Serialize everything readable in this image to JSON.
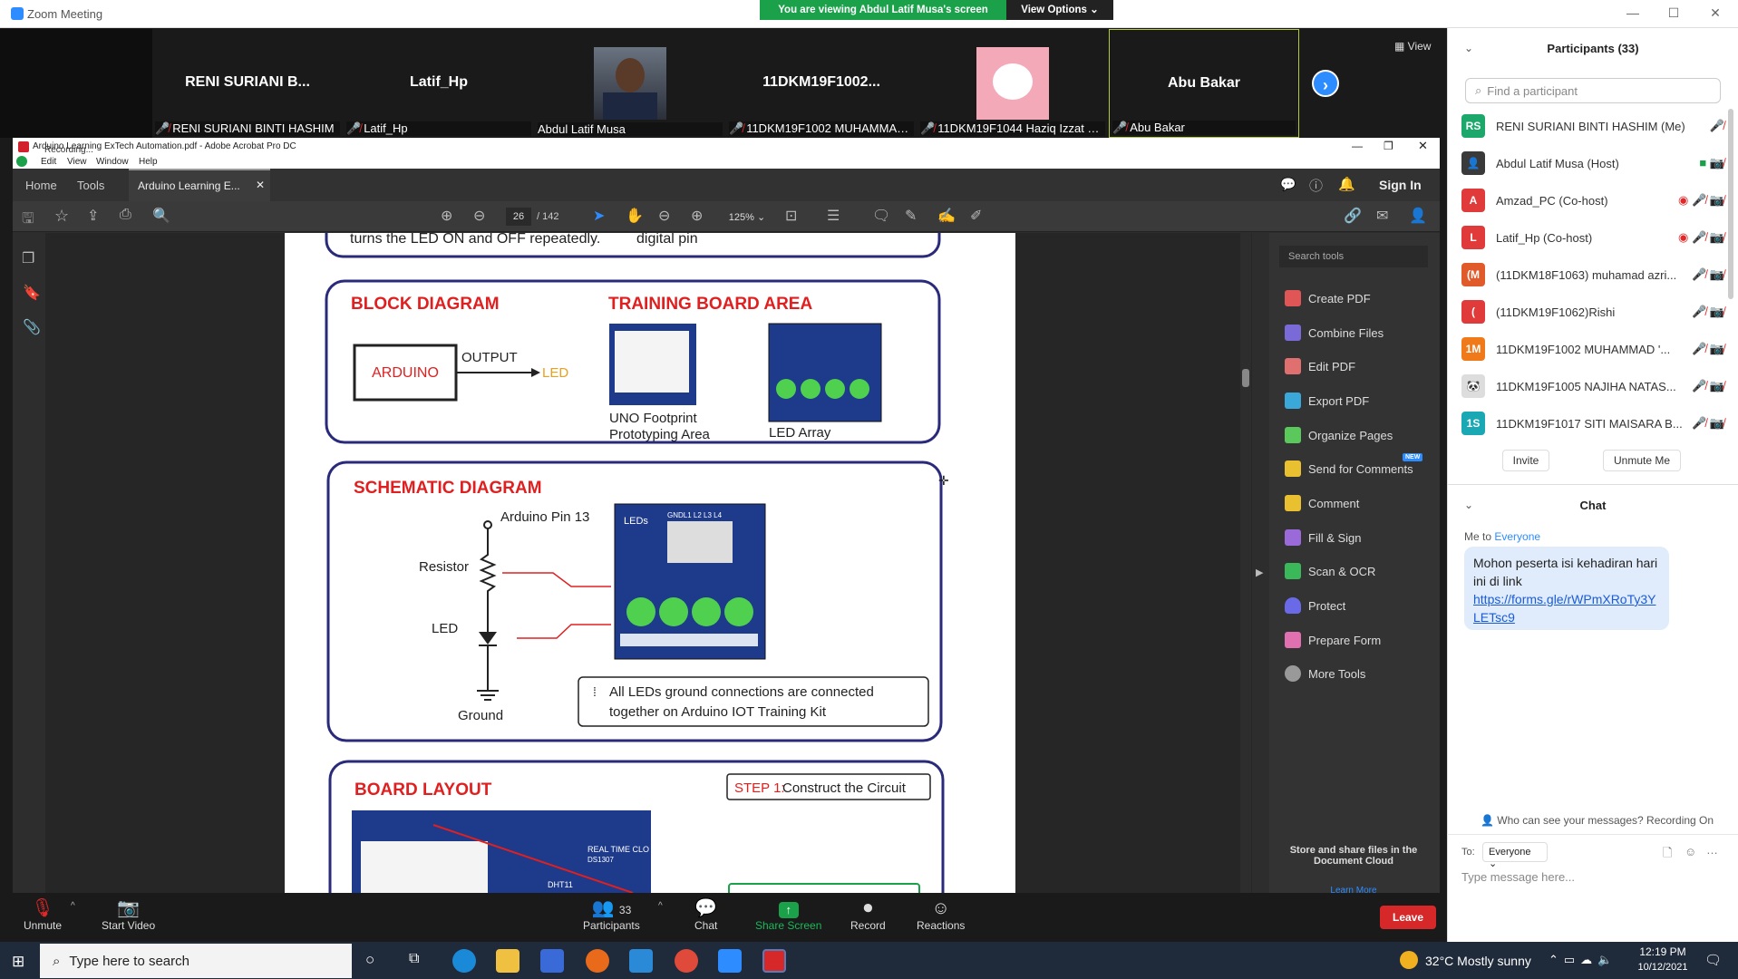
{
  "window": {
    "title": "Zoom Meeting",
    "viewing_banner": "You are viewing Abdul Latif Musa's screen",
    "view_options": "View Options"
  },
  "gallery": {
    "view_label": "View",
    "tiles": [
      {
        "name": "RENI SURIANI B...",
        "label": "RENI SURIANI BINTI HASHIM",
        "muted": true
      },
      {
        "name": "Latif_Hp",
        "label": "Latif_Hp",
        "muted": true
      },
      {
        "name": "",
        "label": "Abdul Latif Musa",
        "muted": false
      },
      {
        "name": "11DKM19F1002...",
        "label": "11DKM19F1002 MUHAMMAD...",
        "muted": true
      },
      {
        "name": "",
        "label": "11DKM19F1044 Haziq Izzat Bi...",
        "muted": true
      },
      {
        "name": "Abu Bakar",
        "label": "Abu Bakar",
        "muted": true
      }
    ]
  },
  "acrobat": {
    "title": "Arduino Learning ExTech Automation.pdf - Adobe Acrobat Pro DC",
    "recording": "Recording...",
    "menu": [
      "Edit",
      "View",
      "Window",
      "Help"
    ],
    "tabs": [
      "Home",
      "Tools",
      "Arduino Learning E..."
    ],
    "sign_in": "Sign In",
    "page_current": "26",
    "page_total": "/ 142",
    "zoom": "125%",
    "search_tools": "Search tools",
    "tools": [
      "Create PDF",
      "Combine Files",
      "Edit PDF",
      "Export PDF",
      "Organize Pages",
      "Send for Comments",
      "Comment",
      "Fill & Sign",
      "Scan & OCR",
      "Protect",
      "Prepare Form",
      "More Tools"
    ],
    "new_badge": "NEW",
    "cloud_promo": "Store and share files in the Document Cloud",
    "learn_more": "Learn More"
  },
  "doc": {
    "top_text_left": "turns the LED ON and OFF repeatedly.",
    "top_text_right": "digital pin",
    "block_title": "BLOCK DIAGRAM",
    "block_arduino": "ARDUINO",
    "block_output": "OUTPUT",
    "block_led": "LED",
    "training_title": "TRAINING BOARD AREA",
    "uno_caption_1": "UNO Footprint",
    "uno_caption_2": "Prototyping Area",
    "led_array": "LED Array",
    "led_board_label": "LEDs",
    "led_board_pins": "GNDL1 L2 L3 L4",
    "led_labels": [
      "L1",
      "L2",
      "L3",
      "L4"
    ],
    "schem_title": "SCHEMATIC DIAGRAM",
    "schem_pin": "Arduino Pin 13",
    "schem_resistor": "Resistor",
    "schem_led": "LED",
    "schem_ground": "Ground",
    "schem_note_1": "All LEDs ground connections are connected",
    "schem_note_2": "together on Arduino IOT Training Kit",
    "board_title": "BOARD LAYOUT",
    "step_label": "STEP 1:",
    "step_text": "Construct the Circuit",
    "rtc_label": "REAL TIME CLO",
    "rtc_code": "DS1307",
    "dht_label": "DHT11"
  },
  "controls": {
    "unmute": "Unmute",
    "start_video": "Start Video",
    "participants": "Participants",
    "participants_count": "33",
    "chat": "Chat",
    "share_screen": "Share Screen",
    "record": "Record",
    "reactions": "Reactions",
    "leave": "Leave"
  },
  "panel": {
    "title": "Participants (33)",
    "find_placeholder": "Find a participant",
    "participants": [
      {
        "initials": "RS",
        "color": "#1ba86a",
        "name": "RENI SURIANI BINTI HASHIM (Me)"
      },
      {
        "initials": "",
        "color": "#555",
        "name": "Abdul Latif Musa (Host)"
      },
      {
        "initials": "A",
        "color": "#e03a3a",
        "name": "Amzad_PC (Co-host)"
      },
      {
        "initials": "L",
        "color": "#e03a3a",
        "name": "Latif_Hp (Co-host)"
      },
      {
        "initials": "(M",
        "color": "#e05a2a",
        "name": "(11DKM18F1063) muhamad azri..."
      },
      {
        "initials": "(",
        "color": "#e03a3a",
        "name": "(11DKM19F1062)Rishi"
      },
      {
        "initials": "1M",
        "color": "#f07a1a",
        "name": "11DKM19F1002 MUHAMMAD '..."
      },
      {
        "initials": "",
        "color": "#ccc",
        "name": "11DKM19F1005 NAJIHA NATAS..."
      },
      {
        "initials": "1S",
        "color": "#1aa8b4",
        "name": "11DKM19F1017 SITI MAISARA B..."
      }
    ],
    "invite": "Invite",
    "unmute_me": "Unmute Me",
    "chat_title": "Chat",
    "chat_from": "Me to",
    "chat_to": "Everyone",
    "chat_message": "Mohon peserta isi kehadiran hari ini di link",
    "chat_link": "https://forms.gle/rWPmXRoTy3YLETsc9",
    "who_can_see": "Who can see your messages? Recording On",
    "to_label": "To:",
    "to_value": "Everyone",
    "type_placeholder": "Type message here..."
  },
  "taskbar": {
    "search_placeholder": "Type here to search",
    "weather": "32°C  Mostly sunny",
    "time": "12:19 PM",
    "date": "10/12/2021"
  }
}
